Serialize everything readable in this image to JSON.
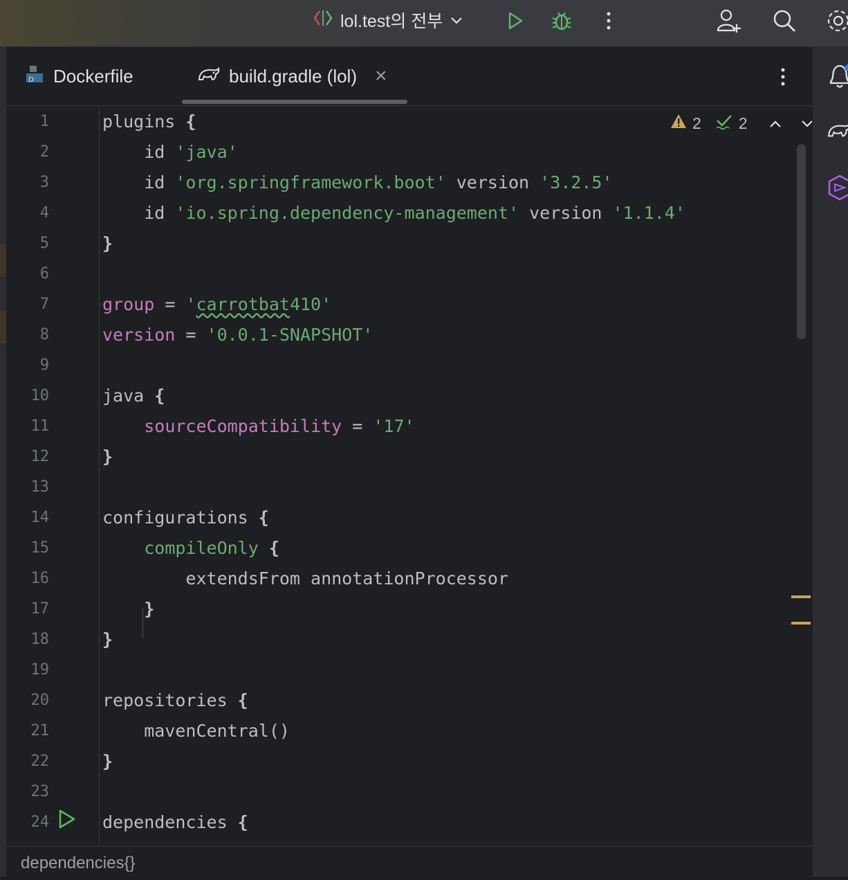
{
  "titlebar": {
    "run_config_label": "lol.test의 전부"
  },
  "tabs": [
    {
      "label": "Dockerfile",
      "icon": "docker-icon",
      "active": false
    },
    {
      "label": "build.gradle (lol)",
      "icon": "gradle-icon",
      "active": true,
      "close": "×"
    }
  ],
  "inspection": {
    "warnings": "2",
    "weak_warnings": "2"
  },
  "line_numbers": [
    "1",
    "2",
    "3",
    "4",
    "5",
    "6",
    "7",
    "8",
    "9",
    "10",
    "11",
    "12",
    "13",
    "14",
    "15",
    "16",
    "17",
    "18",
    "19",
    "20",
    "21",
    "22",
    "23",
    "24"
  ],
  "code": [
    [
      {
        "t": "plugins ",
        "c": "plain"
      },
      {
        "t": "{",
        "c": "brace"
      }
    ],
    [
      {
        "t": "    id ",
        "c": "plain"
      },
      {
        "t": "'java'",
        "c": "str"
      }
    ],
    [
      {
        "t": "    id ",
        "c": "plain"
      },
      {
        "t": "'org.springframework.boot'",
        "c": "str"
      },
      {
        "t": " version ",
        "c": "plain"
      },
      {
        "t": "'3.2.5'",
        "c": "str"
      }
    ],
    [
      {
        "t": "    id ",
        "c": "plain"
      },
      {
        "t": "'io.spring.dependency-management'",
        "c": "str"
      },
      {
        "t": " version ",
        "c": "plain"
      },
      {
        "t": "'1.1.4'",
        "c": "str"
      }
    ],
    [
      {
        "t": "}",
        "c": "brace"
      }
    ],
    [],
    [
      {
        "t": "group",
        "c": "prop"
      },
      {
        "t": " = ",
        "c": "plain"
      },
      {
        "t": "'",
        "c": "str"
      },
      {
        "t": "carrotbat",
        "c": "str typo"
      },
      {
        "t": "410'",
        "c": "str"
      }
    ],
    [
      {
        "t": "version",
        "c": "prop"
      },
      {
        "t": " = ",
        "c": "plain"
      },
      {
        "t": "'0.0.1-SNAPSHOT'",
        "c": "str"
      }
    ],
    [],
    [
      {
        "t": "java ",
        "c": "plain"
      },
      {
        "t": "{",
        "c": "brace"
      }
    ],
    [
      {
        "t": "    ",
        "c": "plain"
      },
      {
        "t": "sourceCompatibility",
        "c": "prop"
      },
      {
        "t": " = ",
        "c": "plain"
      },
      {
        "t": "'17'",
        "c": "str"
      }
    ],
    [
      {
        "t": "}",
        "c": "brace"
      }
    ],
    [],
    [
      {
        "t": "configurations ",
        "c": "plain"
      },
      {
        "t": "{",
        "c": "brace"
      }
    ],
    [
      {
        "t": "    ",
        "c": "plain"
      },
      {
        "t": "compileOnly",
        "c": "green"
      },
      {
        "t": " ",
        "c": "plain"
      },
      {
        "t": "{",
        "c": "brace"
      }
    ],
    [
      {
        "t": "        extendsFrom annotationProcessor",
        "c": "plain"
      }
    ],
    [
      {
        "t": "    ",
        "c": "plain"
      },
      {
        "t": "}",
        "c": "brace"
      }
    ],
    [
      {
        "t": "}",
        "c": "brace"
      }
    ],
    [],
    [
      {
        "t": "repositories ",
        "c": "plain"
      },
      {
        "t": "{",
        "c": "brace"
      }
    ],
    [
      {
        "t": "    mavenCentral()",
        "c": "plain"
      }
    ],
    [
      {
        "t": "}",
        "c": "brace"
      }
    ],
    [],
    [
      {
        "t": "dependencies ",
        "c": "plain"
      },
      {
        "t": "{",
        "c": "brace"
      }
    ]
  ],
  "breadcrumb": "dependencies{}",
  "colors": {
    "string": "#6aab73",
    "property": "#c77dbb",
    "plain": "#bcbec4",
    "run_green": "#5fb865",
    "warning": "#c9a55a"
  }
}
